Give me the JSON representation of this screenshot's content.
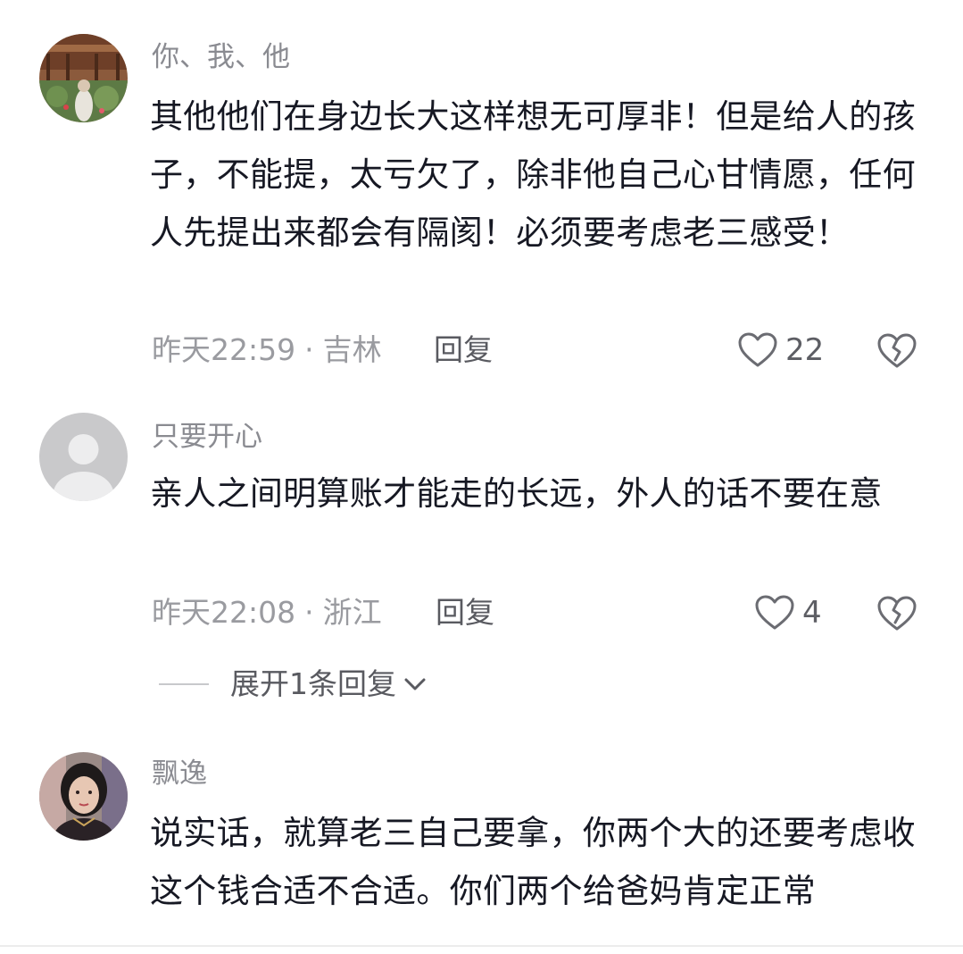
{
  "comments": [
    {
      "username": "你、我、他",
      "content": "其他他们在身边长大这样想无可厚非！但是给人的孩子，不能提，太亏欠了，除非他自己心甘情愿，任何人先提出来都会有隔阂！必须要考虑老三感受！",
      "time": "昨天22:59",
      "location": "吉林",
      "reply_label": "回复",
      "likes": "22",
      "avatar_icon": "garden-photo-avatar"
    },
    {
      "username": "只要开心",
      "content": "亲人之间明算账才能走的长远，外人的话不要在意",
      "time": "昨天22:08",
      "location": "浙江",
      "reply_label": "回复",
      "likes": "4",
      "avatar_icon": "default-user-avatar",
      "expand_label": "展开1条回复"
    },
    {
      "username": "飘逸",
      "content": "说实话，就算老三自己要拿，你两个大的还要考虑收这个钱合适不合适。你们两个给爸妈肯定正常",
      "avatar_icon": "woman-photo-avatar"
    }
  ],
  "meta_separator": "·",
  "colors": {
    "text_primary": "#161823",
    "text_secondary": "#8a8b91",
    "icon_gray": "#6b6c72"
  }
}
